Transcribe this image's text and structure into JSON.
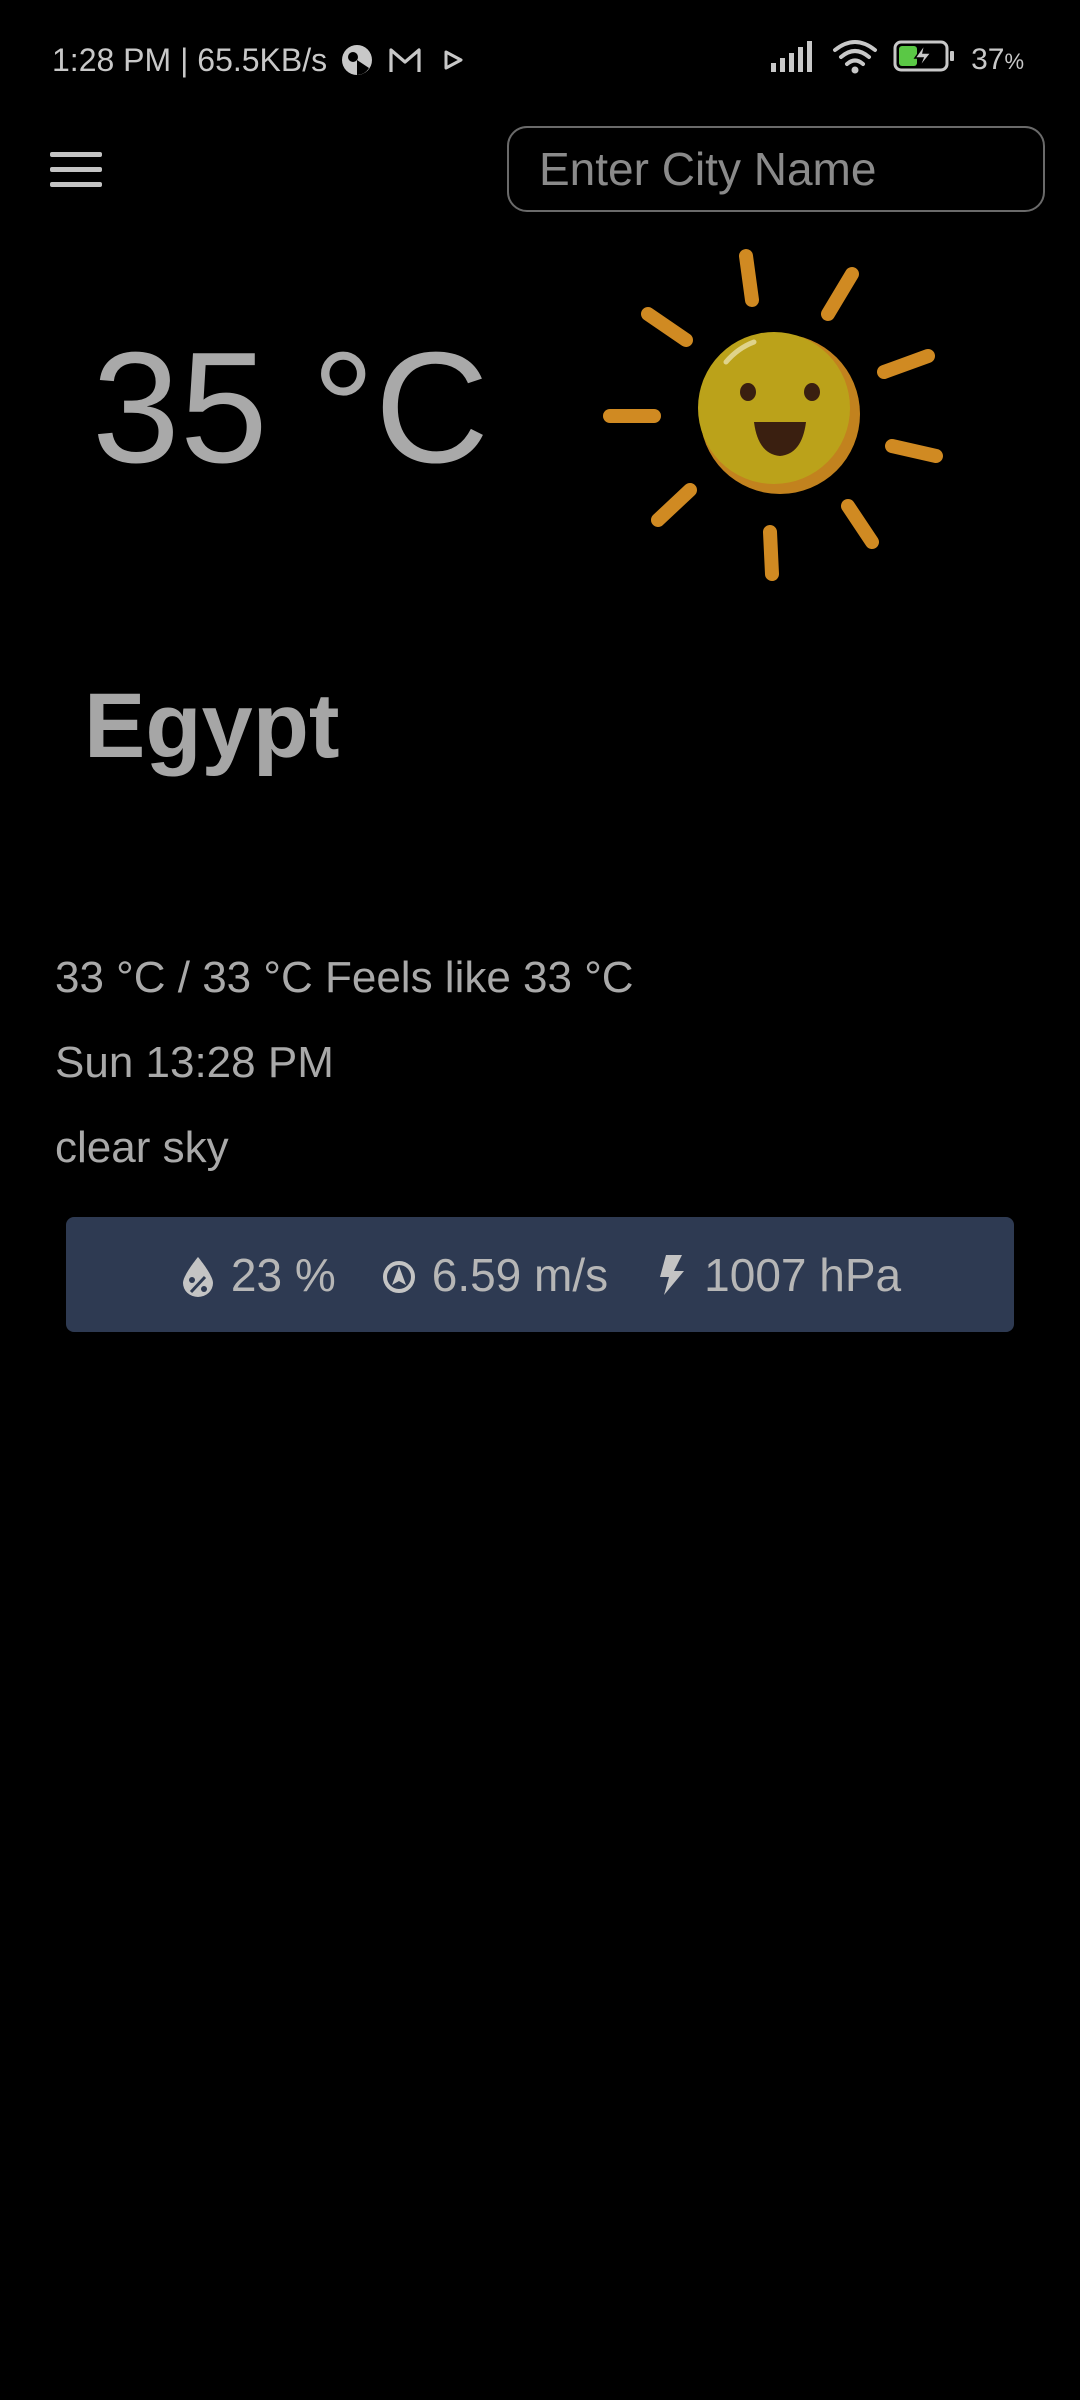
{
  "status_bar": {
    "time_speed": "1:28 PM | 65.5KB/s",
    "battery_percent": "37",
    "percent_sign": "%",
    "icons": [
      "vpn-icon",
      "gmail-icon",
      "play-icon",
      "signal-icon",
      "wifi-icon",
      "battery-charging-icon"
    ]
  },
  "header": {
    "menu_icon": "hamburger-menu-icon",
    "search_placeholder": "Enter City Name",
    "search_value": ""
  },
  "weather": {
    "temperature": "35 °C",
    "icon": "smiling-sun-icon",
    "location": "Egypt",
    "range_feels": "33 °C / 33 °C Feels like 33 °C",
    "datetime": "Sun 13:28 PM",
    "description": "clear sky"
  },
  "stats": {
    "humidity": "23 %",
    "wind": "6.59 m/s",
    "pressure": "1007 hPa",
    "icons": [
      "humidity-drop-icon",
      "wind-compass-icon",
      "pressure-bolt-icon"
    ]
  },
  "colors": {
    "background": "#000000",
    "stats_bar": "#2e3a52",
    "text": "#a9a9a9",
    "sun": "#c9a516",
    "sun_rays": "#d08a22",
    "battery_accent": "#5ac845"
  }
}
